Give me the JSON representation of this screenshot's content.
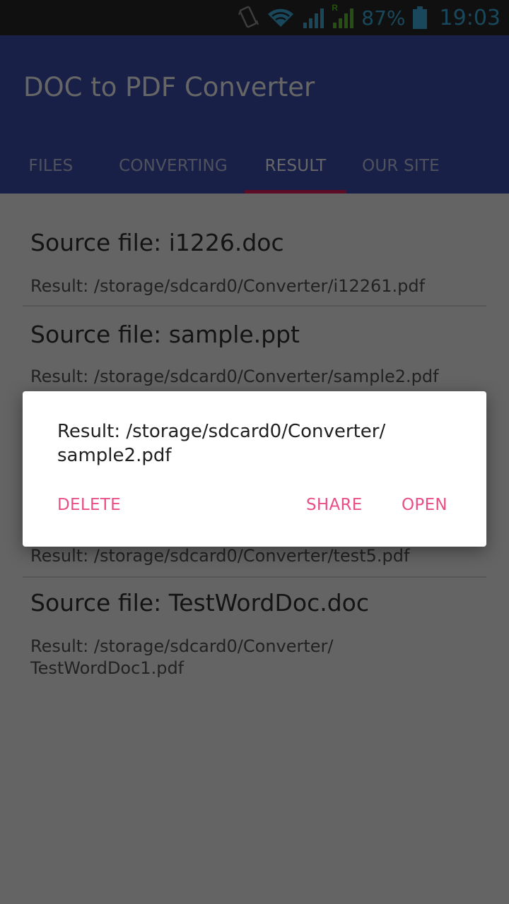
{
  "status_bar": {
    "icons": [
      "vibrate-icon",
      "wifi-icon",
      "signal-icon",
      "roaming-signal-icon",
      "battery-icon"
    ],
    "roaming_label": "R",
    "battery_percent": "87%",
    "time": "19:03",
    "colors": {
      "accent": "#3fb4e5",
      "roaming": "#5cc72c"
    }
  },
  "app_bar": {
    "title": "DOC to PDF Converter",
    "color": "#3f51b5"
  },
  "tabs": [
    {
      "label": "FILES",
      "active": false
    },
    {
      "label": "CONVERTING",
      "active": false
    },
    {
      "label": "RESULT",
      "active": true
    },
    {
      "label": "OUR SITE",
      "active": false
    }
  ],
  "tab_indicator_color": "#e91e63",
  "results": [
    {
      "source": "Source file: i1226.doc",
      "result": "Result: /storage/sdcard0/Converter/i12261.pdf"
    },
    {
      "source": "Source file: sample.ppt",
      "result": "Result: /storage/sdcard0/Converter/sample2.pdf"
    },
    {
      "source": "",
      "result": "Result: /storage/sdcard0/Converter/test5.pdf"
    },
    {
      "source": "Source file: TestWordDoc.doc",
      "result": "Result: /storage/sdcard0/Converter/ TestWordDoc1.pdf"
    }
  ],
  "dialog": {
    "message": "Result: /storage/sdcard0/Converter/ sample2.pdf",
    "buttons": {
      "delete": "DELETE",
      "share": "SHARE",
      "open": "OPEN"
    },
    "button_color": "#e94f86"
  }
}
